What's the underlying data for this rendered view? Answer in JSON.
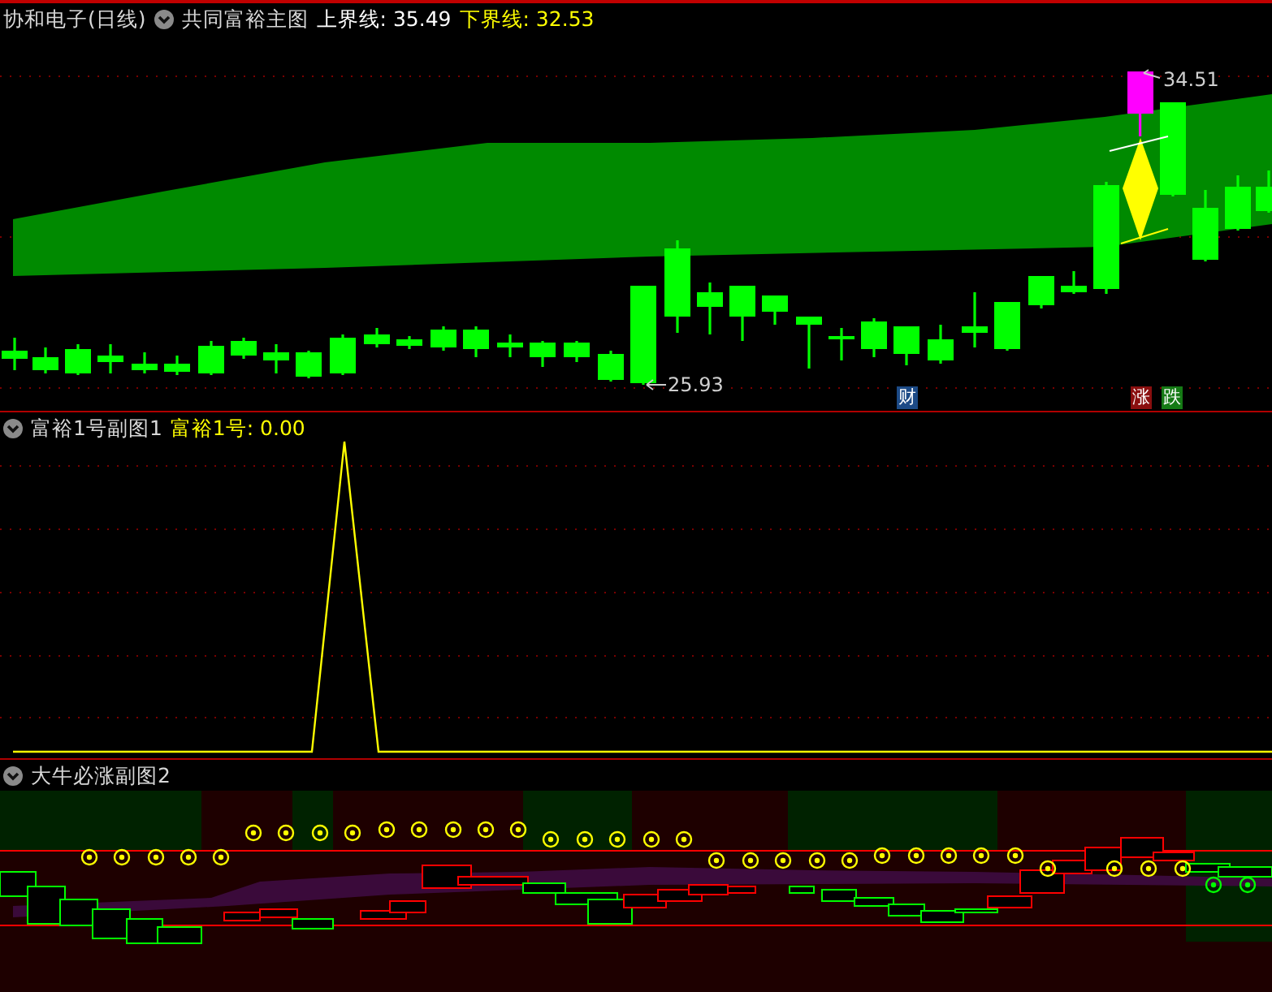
{
  "main_panel": {
    "stock_title": "协和电子(日线)",
    "indicator_name": "共同富裕主图",
    "upper_line": "上界线: 35.49",
    "lower_line": "下界线: 32.53",
    "high_price": "34.51",
    "low_price": "25.93",
    "markers": [
      {
        "text": "财",
        "color": "#1c4a86"
      },
      {
        "text": "涨",
        "color": "#8a0f0f"
      },
      {
        "text": "跌",
        "color": "#157a15"
      }
    ]
  },
  "sub_panel_1": {
    "indicator_name": "富裕1号副图1",
    "value_label": "富裕1号: 0.00"
  },
  "sub_panel_2": {
    "indicator_name": "大牛必涨副图2"
  }
}
